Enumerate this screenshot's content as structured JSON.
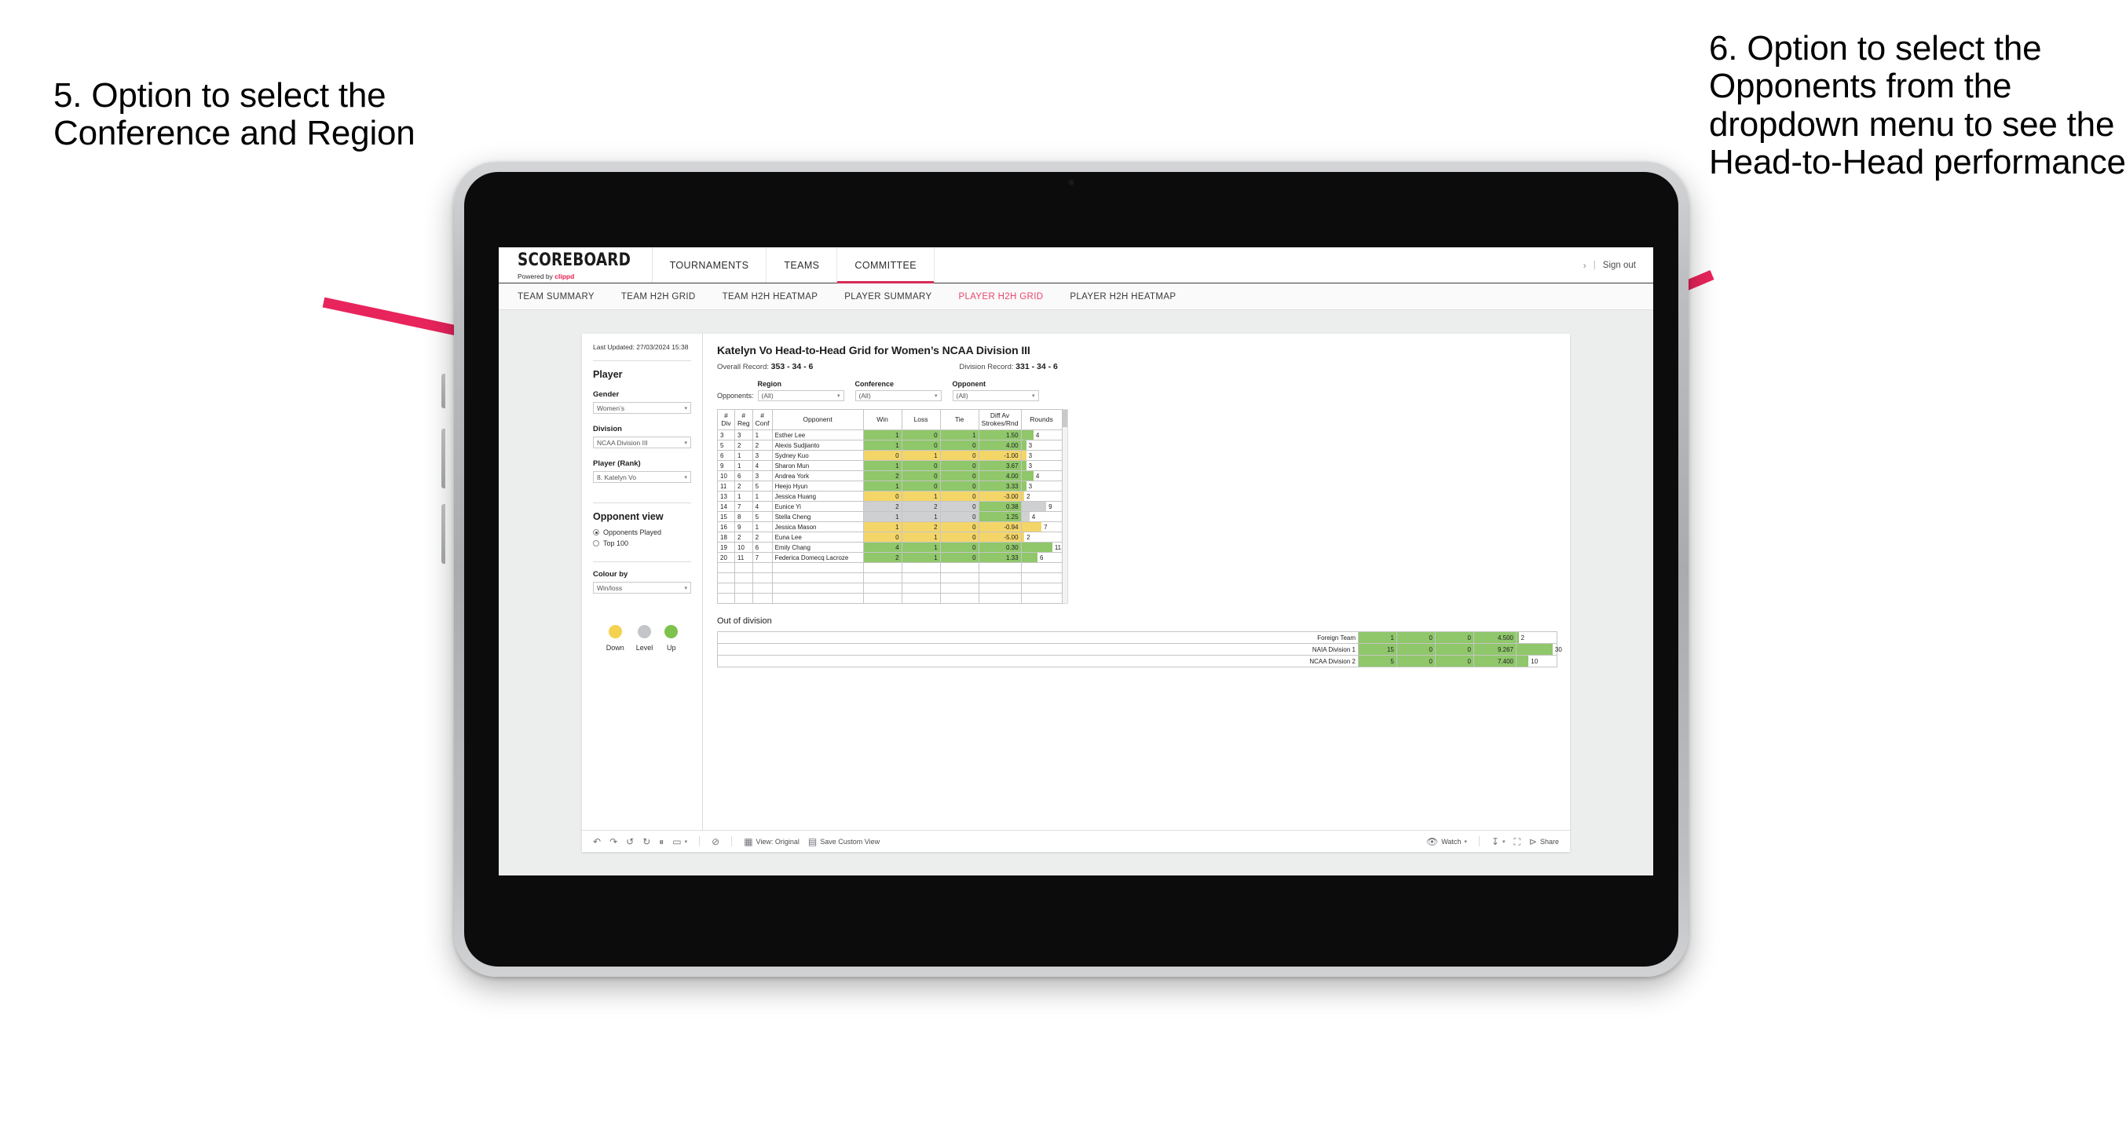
{
  "annotations": {
    "left": "5. Option to select the Conference and Region",
    "right": "6. Option to select the Opponents from the dropdown menu to see the Head-to-Head performance",
    "arrow_color": "#e8245c"
  },
  "app": {
    "brand": {
      "title": "SCOREBOARD",
      "powered_prefix": "Powered by ",
      "powered_brand": "clippd"
    },
    "topnav": [
      {
        "label": "TOURNAMENTS",
        "active": false
      },
      {
        "label": "TEAMS",
        "active": false
      },
      {
        "label": "COMMITTEE",
        "active": true
      }
    ],
    "topbar_right": {
      "chevron": "›",
      "separator": "|",
      "sign_out": "Sign out"
    },
    "subnav": [
      {
        "label": "TEAM SUMMARY",
        "active": false
      },
      {
        "label": "TEAM H2H GRID",
        "active": false
      },
      {
        "label": "TEAM H2H HEATMAP",
        "active": false
      },
      {
        "label": "PLAYER SUMMARY",
        "active": false
      },
      {
        "label": "PLAYER H2H GRID",
        "active": true
      },
      {
        "label": "PLAYER H2H HEATMAP",
        "active": false
      }
    ],
    "accent": "#e8456d"
  },
  "sidebar": {
    "last_updated": "Last Updated: 27/03/2024 15:38",
    "section_player": "Player",
    "fields": [
      {
        "label": "Gender",
        "value": "Women’s"
      },
      {
        "label": "Division",
        "value": "NCAA Division III"
      },
      {
        "label": "Player (Rank)",
        "value": "8. Katelyn Vo"
      }
    ],
    "opponent_view": {
      "heading": "Opponent view",
      "options": [
        {
          "label": "Opponents Played",
          "selected": true
        },
        {
          "label": "Top 100",
          "selected": false
        }
      ]
    },
    "colour_by": {
      "label": "Colour by",
      "value": "Win/loss"
    },
    "legend": [
      {
        "label": "Down",
        "color": "#f4d14f"
      },
      {
        "label": "Level",
        "color": "#c3c5c8"
      },
      {
        "label": "Up",
        "color": "#7dc24c"
      }
    ]
  },
  "main": {
    "title": "Katelyn Vo Head-to-Head Grid for Women’s NCAA Division III",
    "overall_record_label": "Overall Record:",
    "overall_record_value": "353 -  34 - 6",
    "division_record_label": "Division Record:",
    "division_record_value": "331 -  34 - 6",
    "opponents_label": "Opponents:",
    "filters": [
      {
        "caption": "Region",
        "value": "(All)"
      },
      {
        "caption": "Conference",
        "value": "(All)"
      },
      {
        "caption": "Opponent",
        "value": "(All)"
      }
    ],
    "columns": [
      {
        "l1": "#",
        "l2": "Div"
      },
      {
        "l1": "#",
        "l2": "Reg"
      },
      {
        "l1": "#",
        "l2": "Conf"
      },
      {
        "l1": "Opponent",
        "l2": ""
      },
      {
        "l1": "Win",
        "l2": ""
      },
      {
        "l1": "Loss",
        "l2": ""
      },
      {
        "l1": "Tie",
        "l2": ""
      },
      {
        "l1": "Diff Av",
        "l2": "Strokes/Rnd"
      },
      {
        "l1": "Rounds",
        "l2": ""
      }
    ],
    "rows": [
      {
        "div": "3",
        "reg": "3",
        "conf": "1",
        "opponent": "Esther Lee",
        "win": "1",
        "loss": "0",
        "tie": "1",
        "diff": "1.50",
        "rounds": "4",
        "state": "up",
        "bar_pct": 30
      },
      {
        "div": "5",
        "reg": "2",
        "conf": "2",
        "opponent": "Alexis Sudjianto",
        "win": "1",
        "loss": "0",
        "tie": "0",
        "diff": "4.00",
        "rounds": "3",
        "state": "up",
        "bar_pct": 12
      },
      {
        "div": "6",
        "reg": "1",
        "conf": "3",
        "opponent": "Sydney Kuo",
        "win": "0",
        "loss": "1",
        "tie": "0",
        "diff": "-1.00",
        "rounds": "3",
        "state": "down",
        "bar_pct": 12
      },
      {
        "div": "9",
        "reg": "1",
        "conf": "4",
        "opponent": "Sharon Mun",
        "win": "1",
        "loss": "0",
        "tie": "0",
        "diff": "3.67",
        "rounds": "3",
        "state": "up",
        "bar_pct": 12
      },
      {
        "div": "10",
        "reg": "6",
        "conf": "3",
        "opponent": "Andrea York",
        "win": "2",
        "loss": "0",
        "tie": "0",
        "diff": "4.00",
        "rounds": "4",
        "state": "up",
        "bar_pct": 30
      },
      {
        "div": "11",
        "reg": "2",
        "conf": "5",
        "opponent": "Heejo Hyun",
        "win": "1",
        "loss": "0",
        "tie": "0",
        "diff": "3.33",
        "rounds": "3",
        "state": "up",
        "bar_pct": 12
      },
      {
        "div": "13",
        "reg": "1",
        "conf": "1",
        "opponent": "Jessica Huang",
        "win": "0",
        "loss": "1",
        "tie": "0",
        "diff": "-3.00",
        "rounds": "2",
        "state": "down",
        "bar_pct": 7
      },
      {
        "div": "14",
        "reg": "7",
        "conf": "4",
        "opponent": "Eunice Yi",
        "win": "2",
        "loss": "2",
        "tie": "0",
        "diff": "0.38",
        "rounds": "9",
        "state": "level",
        "bar_pct": 62,
        "diff_state": "up"
      },
      {
        "div": "15",
        "reg": "8",
        "conf": "5",
        "opponent": "Stella Cheng",
        "win": "1",
        "loss": "1",
        "tie": "0",
        "diff": "1.25",
        "rounds": "4",
        "state": "level",
        "bar_pct": 20,
        "diff_state": "up"
      },
      {
        "div": "16",
        "reg": "9",
        "conf": "1",
        "opponent": "Jessica Mason",
        "win": "1",
        "loss": "2",
        "tie": "0",
        "diff": "-0.94",
        "rounds": "7",
        "state": "down",
        "bar_pct": 50
      },
      {
        "div": "18",
        "reg": "2",
        "conf": "2",
        "opponent": "Euna Lee",
        "win": "0",
        "loss": "1",
        "tie": "0",
        "diff": "-5.00",
        "rounds": "2",
        "state": "down",
        "bar_pct": 7
      },
      {
        "div": "19",
        "reg": "10",
        "conf": "6",
        "opponent": "Emily Chang",
        "win": "4",
        "loss": "1",
        "tie": "0",
        "diff": "0.30",
        "rounds": "11",
        "state": "up",
        "bar_pct": 77
      },
      {
        "div": "20",
        "reg": "11",
        "conf": "7",
        "opponent": "Federica Domecq Lacroze",
        "win": "2",
        "loss": "1",
        "tie": "0",
        "diff": "1.33",
        "rounds": "6",
        "state": "up",
        "bar_pct": 40
      }
    ],
    "out_of_division": {
      "title": "Out of division",
      "rows": [
        {
          "name": "Foreign Team",
          "win": "1",
          "loss": "0",
          "tie": "0",
          "diff": "4.500",
          "rounds": "2",
          "state": "up",
          "bar_pct": 5
        },
        {
          "name": "NAIA Division 1",
          "win": "15",
          "loss": "0",
          "tie": "0",
          "diff": "9.267",
          "rounds": "30",
          "state": "up",
          "bar_pct": 90
        },
        {
          "name": "NCAA Division 2",
          "win": "5",
          "loss": "0",
          "tie": "0",
          "diff": "7.400",
          "rounds": "10",
          "state": "up",
          "bar_pct": 30
        }
      ]
    }
  },
  "toolbar": {
    "undo": "↶",
    "redo": "↷",
    "revert": "↺",
    "refresh": "↻",
    "pause": "⏸",
    "share_view": "▭",
    "caret": "▾",
    "separator": "|",
    "alert": "⊘",
    "view_label": "View: Original",
    "save_label": "Save Custom View",
    "watch_label": "Watch",
    "download_caret": "▾",
    "fullscreen_label": "fullscreen",
    "share_label": "Share"
  }
}
